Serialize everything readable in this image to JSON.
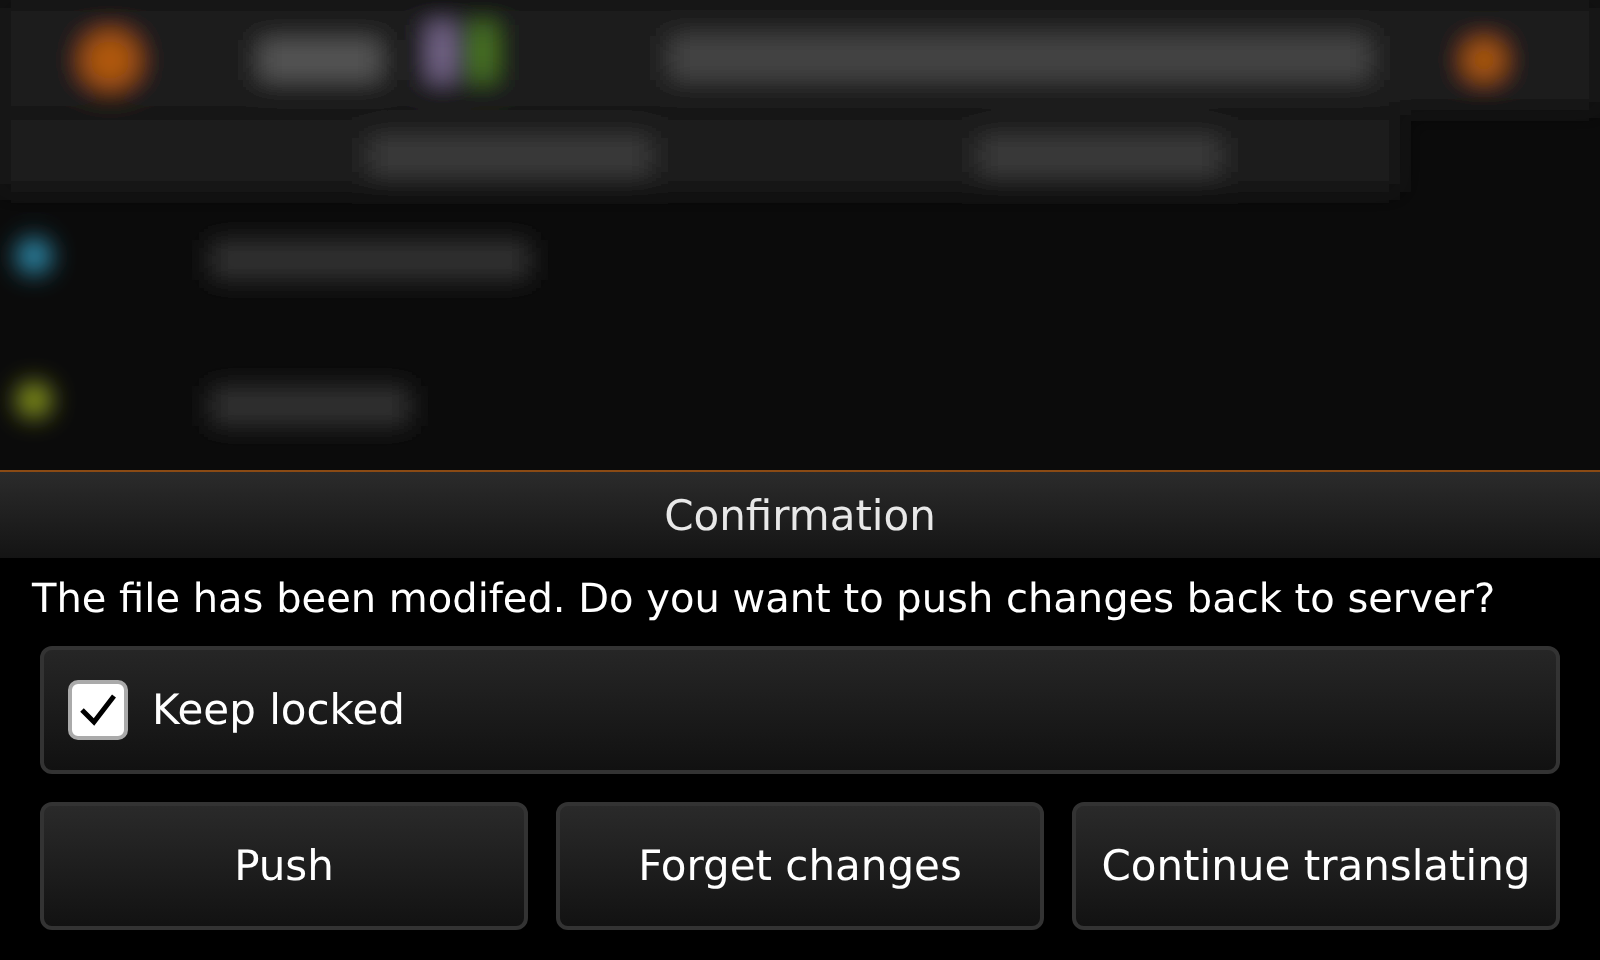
{
  "dialog": {
    "title": "Confirmation",
    "message": "The file has been modifed. Do you want to push changes back to server?",
    "checkbox": {
      "label": "Keep locked",
      "checked": true
    },
    "buttons": [
      "Push",
      "Forget changes",
      "Continue translating"
    ]
  }
}
